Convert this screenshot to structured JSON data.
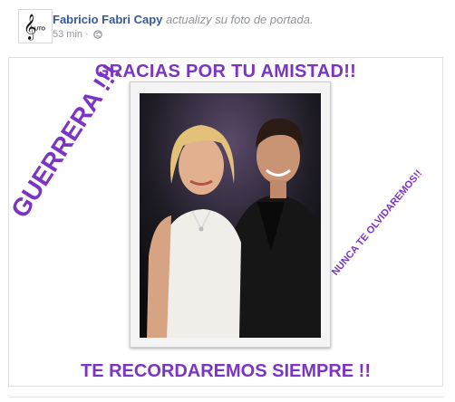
{
  "post": {
    "author_name": "Fabricio Fabri Capy",
    "action_text": "actualizy su foto de portada.",
    "timestamp": "53 min",
    "meta_separator": "·",
    "privacy_icon": "globe-icon",
    "avatar_icon": "treble-clef-icon",
    "avatar_label": "UTO"
  },
  "cover_image": {
    "top_text": "GRACIAS POR TU AMISTAD!!",
    "left_text": "GUERRERA !!!",
    "right_text": "NUNCA TE OLVIDAREMOS!!",
    "bottom_text": "TE RECORDAREMOS SIEMPRE !!",
    "text_color": "#7a35c4"
  },
  "colors": {
    "link": "#365899",
    "meta": "#90949c"
  }
}
